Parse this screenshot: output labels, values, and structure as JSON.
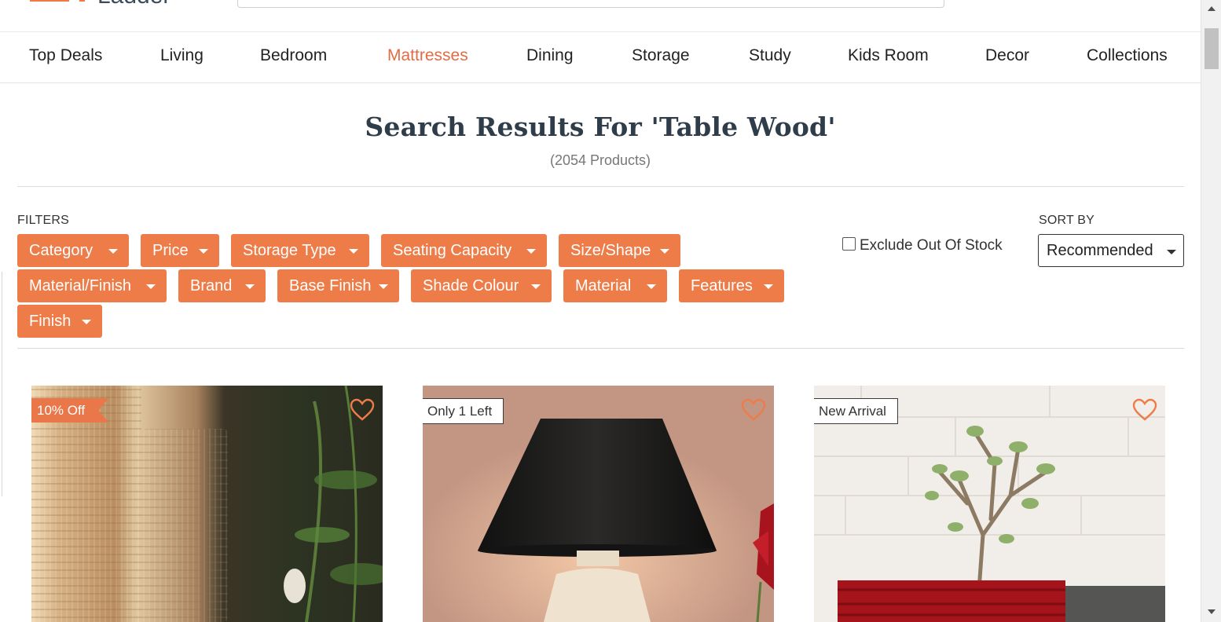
{
  "header": {
    "logo_text": "Ladder"
  },
  "nav": {
    "items": [
      "Top Deals",
      "Living",
      "Bedroom",
      "Mattresses",
      "Dining",
      "Storage",
      "Study",
      "Kids Room",
      "Decor",
      "Collections"
    ],
    "active": "Mattresses"
  },
  "results": {
    "title": "Search Results For 'Table Wood'",
    "count": "(2054 Products)"
  },
  "filters": {
    "label": "FILTERS",
    "chips": [
      "Category",
      "Price",
      "Storage Type",
      "Seating Capacity",
      "Size/Shape",
      "Material/Finish",
      "Brand",
      "Base Finish",
      "Shade Colour",
      "Material",
      "Features",
      "Finish"
    ],
    "exclude_out_of_stock": {
      "label": "Exclude Out Of Stock",
      "checked": false
    }
  },
  "sort": {
    "label": "SORT BY",
    "selected": "Recommended"
  },
  "products": [
    {
      "tag": "10% Off",
      "tag_style": "discount",
      "wishlist_icon": "heart-outline-icon"
    },
    {
      "tag": "Only 1 Left",
      "tag_style": "outline",
      "wishlist_icon": "heart-outline-icon"
    },
    {
      "tag": "New Arrival",
      "tag_style": "outline",
      "wishlist_icon": "heart-outline-icon"
    }
  ],
  "colors": {
    "accent": "#ee7c49",
    "active_nav": "#e16c43",
    "title": "#2f3c4a"
  }
}
